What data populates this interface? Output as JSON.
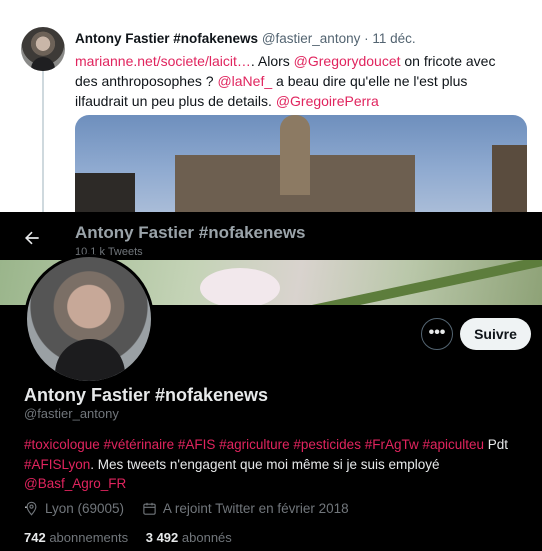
{
  "tweet": {
    "author_name": "Antony Fastier #nofakenews",
    "author_handle": "@fastier_antony",
    "separator": "·",
    "date": "11 déc.",
    "link_url": "marianne.net/societe/laicit…",
    "text_after_link": ". Alors ",
    "mention_1": "@Gregorydoucet",
    "text_2": " on fricote avec des anthroposophes ? ",
    "mention_2": "@laNef_",
    "text_3": " a beau dire qu'elle ne l'est plus ilfaudrait un peu plus de details. ",
    "mention_3": "@GregoirePerra"
  },
  "profile": {
    "header_title": "Antony Fastier #nofakenews",
    "header_tweet_count": "10,1 k Tweets",
    "more_label": "•••",
    "follow_label": "Suivre",
    "display_name": "Antony Fastier #nofakenews",
    "handle": "@fastier_antony",
    "bio": {
      "hashtags_1": "#toxicologue #vétérinaire #AFIS #agriculture #pesticides  #FrAgTw #apiculteu",
      "text_1": " Pdt ",
      "hashtag_2": "#AFISLyon",
      "text_2": ". Mes tweets n'engagent que moi même si je suis employé ",
      "mention": "@Basf_Agro_FR",
      "text_3": "."
    },
    "location": "Lyon (69005)",
    "joined": "A rejoint Twitter en février 2018",
    "following_count": "742",
    "following_label": "abonnements",
    "followers_count": "3 492",
    "followers_label": "abonnés"
  },
  "colors": {
    "link": "#e0245e",
    "profile_bg": "#000000",
    "tweet_bg": "#ffffff"
  }
}
